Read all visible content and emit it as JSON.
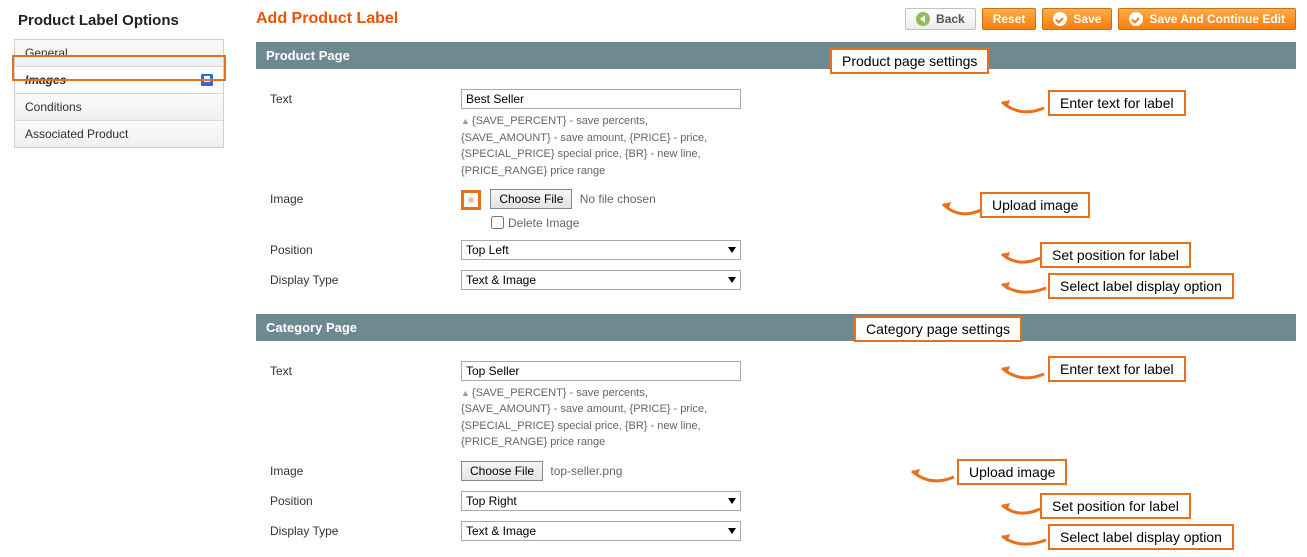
{
  "sidebar": {
    "title": "Product Label Options",
    "items": [
      {
        "label": "General"
      },
      {
        "label": "Images"
      },
      {
        "label": "Conditions"
      },
      {
        "label": "Associated Product"
      }
    ]
  },
  "header": {
    "title": "Add Product Label",
    "back": "Back",
    "reset": "Reset",
    "save": "Save",
    "save_continue": "Save And Continue Edit"
  },
  "product_page": {
    "section_title": "Product Page",
    "text_label": "Text",
    "text_value": "Best Seller",
    "hints_l1": "{SAVE_PERCENT} - save percents,",
    "hints_l2": "{SAVE_AMOUNT} - save amount, {PRICE} - price,",
    "hints_l3": "{SPECIAL_PRICE} special price, {BR} - new line,",
    "hints_l4": "{PRICE_RANGE} price range",
    "image_label": "Image",
    "choose_file": "Choose File",
    "file_name": "No file chosen",
    "delete_image": "Delete Image",
    "position_label": "Position",
    "position_value": "Top Left",
    "display_label": "Display Type",
    "display_value": "Text & Image"
  },
  "category_page": {
    "section_title": "Category Page",
    "text_label": "Text",
    "text_value": "Top Seller",
    "hints_l1": "{SAVE_PERCENT} - save percents,",
    "hints_l2": "{SAVE_AMOUNT} - save amount, {PRICE} - price,",
    "hints_l3": "{SPECIAL_PRICE} special price, {BR} - new line,",
    "hints_l4": "{PRICE_RANGE} price range",
    "image_label": "Image",
    "choose_file": "Choose File",
    "file_name": "top-seller.png",
    "position_label": "Position",
    "position_value": "Top Right",
    "display_label": "Display Type",
    "display_value": "Text & Image"
  },
  "annotations": {
    "pp_settings": "Product page settings",
    "pp_text": "Enter text for label",
    "pp_image": "Upload image",
    "pp_position": "Set position for label",
    "pp_display": "Select label display option",
    "cp_settings": "Category page settings",
    "cp_text": "Enter text for label",
    "cp_image": "Upload image",
    "cp_position": "Set position for label",
    "cp_display": "Select label display option"
  }
}
